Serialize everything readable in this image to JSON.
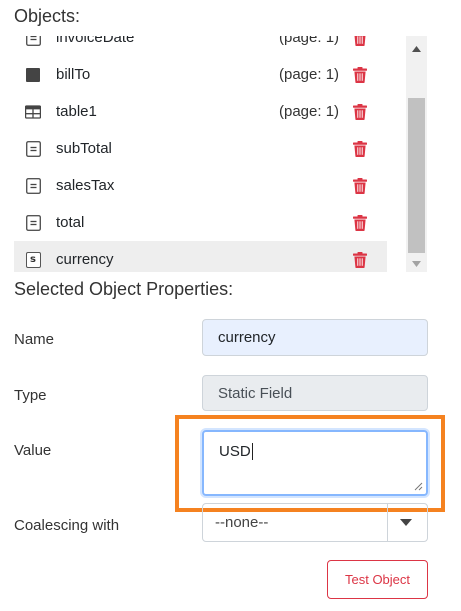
{
  "objects_panel": {
    "title": "Objects:",
    "items": [
      {
        "name": "invoiceDate",
        "page": "(page: 1)",
        "icon": "field-icon",
        "selected": false
      },
      {
        "name": "billTo",
        "page": "(page: 1)",
        "icon": "square-icon",
        "selected": false
      },
      {
        "name": "table1",
        "page": "(page: 1)",
        "icon": "table-icon",
        "selected": false
      },
      {
        "name": "subTotal",
        "page": "",
        "icon": "field-icon",
        "selected": false
      },
      {
        "name": "salesTax",
        "page": "",
        "icon": "field-icon",
        "selected": false
      },
      {
        "name": "total",
        "page": "",
        "icon": "field-icon",
        "selected": false
      },
      {
        "name": "currency",
        "page": "",
        "icon": "static-field-icon",
        "selected": true
      }
    ],
    "static_icon_letter": "s",
    "trash_color": "#dc3545"
  },
  "properties": {
    "title": "Selected Object Properties:",
    "name_label": "Name",
    "name_value": "currency",
    "type_label": "Type",
    "type_value": "Static Field",
    "value_label": "Value",
    "value_value": "USD",
    "coalescing_label": "Coalescing with",
    "coalescing_value": "--none--"
  },
  "actions": {
    "test_label": "Test Object"
  },
  "colors": {
    "highlight": "#f58220",
    "danger": "#dc3545",
    "focus": "#86b7fe"
  }
}
